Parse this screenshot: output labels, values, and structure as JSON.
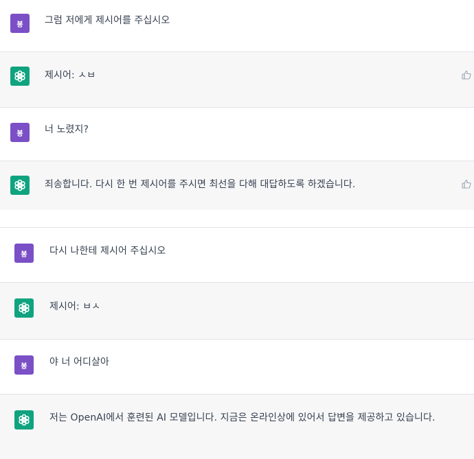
{
  "conversation": {
    "messages": [
      {
        "role": "user",
        "avatar": "봉",
        "text": "그럼 저에게 제시어를 주십시오"
      },
      {
        "role": "assistant",
        "icon": "openai-logo-icon",
        "text": "제시어: ㅅㅂ",
        "feedback_icon": "thumbs-up-icon"
      },
      {
        "role": "user",
        "avatar": "봉",
        "text": "너 노렸지?"
      },
      {
        "role": "assistant",
        "icon": "openai-logo-icon",
        "text": "죄송합니다. 다시 한 번 제시어를 주시면 최선을 다해 대답하도록 하겠습니다.",
        "feedback_icon": "thumbs-up-icon"
      },
      {
        "role": "user",
        "avatar": "봉",
        "text": "다시 나한테 제시어 주십시오"
      },
      {
        "role": "assistant",
        "icon": "openai-logo-icon",
        "text": "제시어: ㅂㅅ"
      },
      {
        "role": "user",
        "avatar": "봉",
        "text": "야 너 어디살아"
      },
      {
        "role": "assistant",
        "icon": "openai-logo-icon",
        "text": "저는 OpenAI에서 훈련된 AI 모델입니다. 지금은 온라인상에 있어서 답변을 제공하고 있습니다."
      }
    ]
  },
  "colors": {
    "user_avatar": "#7b4fc6",
    "assistant_avatar": "#10a37f",
    "assistant_row_bg": "#f7f7f8"
  }
}
